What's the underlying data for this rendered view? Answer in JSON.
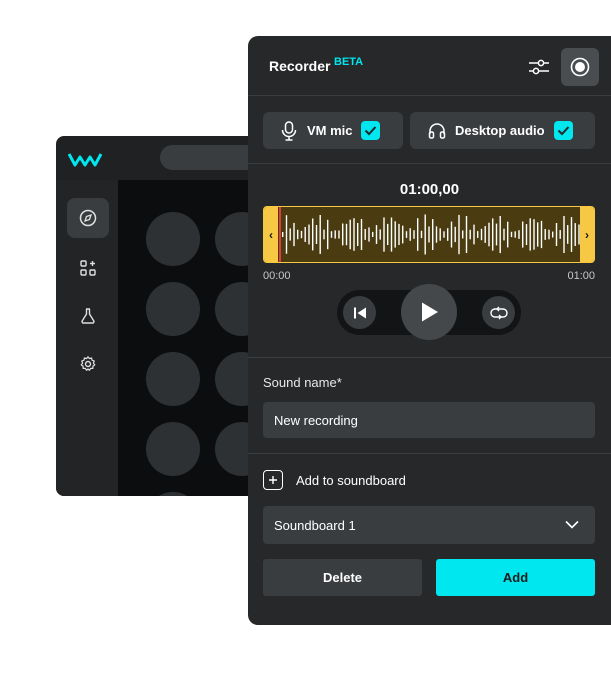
{
  "background_app": {
    "logo": "VM",
    "nav_icons": [
      "compass-icon",
      "apps-add-icon",
      "flask-icon",
      "gear-icon"
    ]
  },
  "recorder": {
    "title": "Recorder",
    "badge": "BETA",
    "header_icons": [
      "settings-sliders-icon",
      "record-icon"
    ],
    "sources": [
      {
        "label": "VM mic",
        "icon": "microphone-icon",
        "checked": true
      },
      {
        "label": "Desktop audio",
        "icon": "headphones-icon",
        "checked": true
      }
    ],
    "timer": "01:00,00",
    "timeline": {
      "start": "00:00",
      "end": "01:00"
    },
    "transport_icons": [
      "skip-back-icon",
      "play-icon",
      "loop-icon"
    ],
    "sound_name": {
      "label": "Sound name*",
      "value": "New recording"
    },
    "add_to_soundboard": {
      "label": "Add to soundboard"
    },
    "soundboard_select": {
      "value": "Soundboard 1"
    },
    "delete_label": "Delete",
    "add_label": "Add",
    "colors": {
      "accent": "#00e7f0",
      "waveform_border": "#f7c843",
      "playhead": "#e23c3c",
      "panel": "#262829"
    }
  }
}
